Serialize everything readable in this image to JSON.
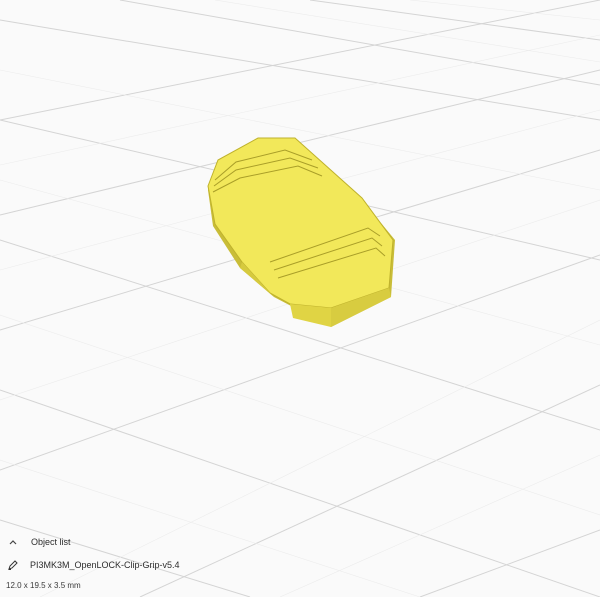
{
  "viewport": {
    "background": "#fafafa",
    "grid_color": "#cfcfcf",
    "model_color": "#f2e85a",
    "model_shade": "#c9bd38"
  },
  "object_list": {
    "toggle_icon": "chevron-up-icon",
    "toggle_label": "Object list",
    "edit_icon": "pencil-icon",
    "object_name": "PI3MK3M_OpenLOCK-Clip-Grip-v5.4",
    "dimensions": "12.0 x 19.5 x 3.5 mm"
  }
}
